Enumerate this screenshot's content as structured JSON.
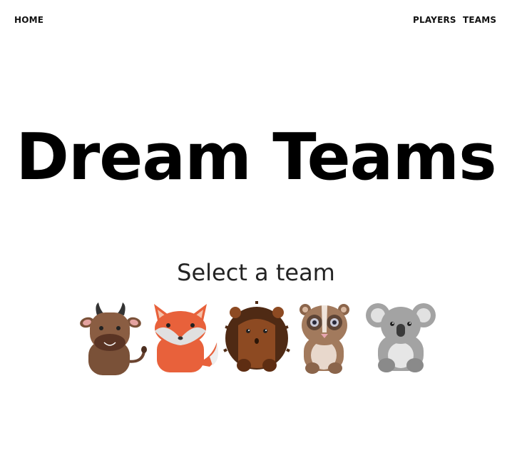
{
  "nav": {
    "home": "HOME",
    "players": "PLAYERS",
    "teams": "TEAMS"
  },
  "hero": {
    "title": "Dream Teams"
  },
  "teams_section": {
    "heading": "Select a team",
    "mascots": [
      {
        "icon": "bull-icon"
      },
      {
        "icon": "fox-icon"
      },
      {
        "icon": "hedgehog-icon"
      },
      {
        "icon": "lemur-icon"
      },
      {
        "icon": "koala-icon"
      }
    ]
  },
  "colors": {
    "bull_body": "#7a5138",
    "fox_body": "#e8613b",
    "hedgehog_body": "#8d4a22",
    "lemur_body": "#a27a5d",
    "koala_body": "#9b9b9b"
  }
}
